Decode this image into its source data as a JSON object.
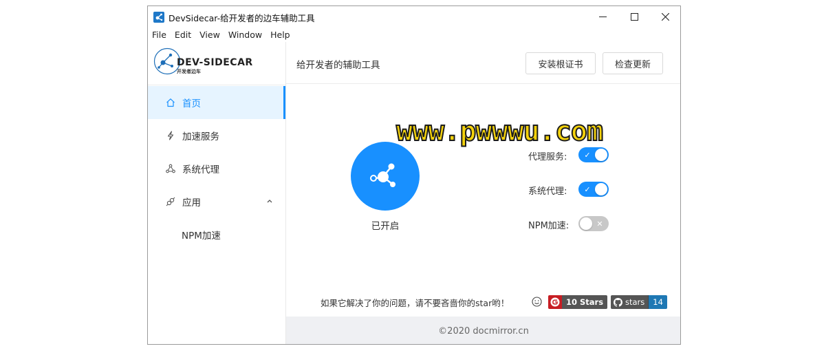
{
  "window": {
    "title": "DevSidecar-给开发者的边车辅助工具"
  },
  "menu": [
    "File",
    "Edit",
    "View",
    "Window",
    "Help"
  ],
  "logo": {
    "text": "DEV-SIDECAR",
    "sub": "开发者边车"
  },
  "sidebar": {
    "items": [
      {
        "label": "首页",
        "icon": "home-icon",
        "active": true
      },
      {
        "label": "加速服务",
        "icon": "thunderbolt-icon"
      },
      {
        "label": "系统代理",
        "icon": "cluster-icon"
      },
      {
        "label": "应用",
        "icon": "api-icon",
        "expanded": true
      }
    ],
    "sub_items": [
      {
        "label": "NPM加速"
      }
    ]
  },
  "header": {
    "title": "给开发者的辅助工具",
    "install_cert_label": "安装根证书",
    "check_update_label": "检查更新"
  },
  "watermark": "www.pwwwu.com",
  "main": {
    "status_text": "已开启",
    "options": [
      {
        "label": "代理服务:",
        "on": true
      },
      {
        "label": "系统代理:",
        "on": true
      },
      {
        "label": "NPM加速:",
        "on": false
      }
    ],
    "thanks_text": "如果它解决了你的问题，请不要吝啬你的star哟！",
    "gitee_badge": "10 Stars",
    "github_badge_label": "stars",
    "github_badge_count": "14"
  },
  "footer": {
    "text": "©2020 docmirror.cn"
  },
  "colors": {
    "primary": "#1890ff",
    "active_bg": "#e6f4ff",
    "footer_bg": "#eff0f3",
    "gitee": "#c71d23",
    "github_count": "#1e78b4"
  }
}
